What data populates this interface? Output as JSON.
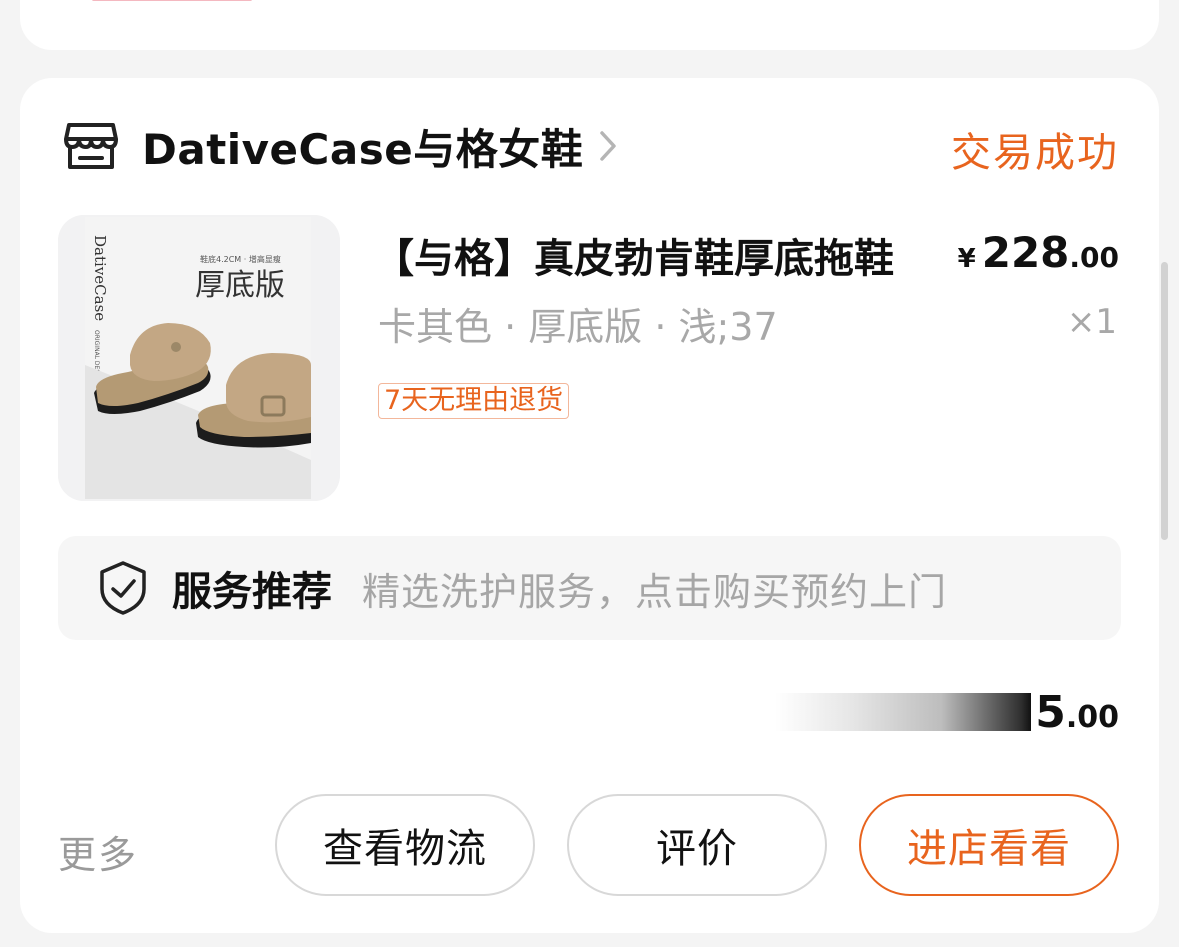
{
  "order": {
    "shop": {
      "name": "DativeCase与格女鞋",
      "icon": "store-icon"
    },
    "status": "交易成功",
    "product": {
      "title": "【与格】真皮勃肯鞋厚底拖鞋",
      "price_currency": "¥",
      "price_int": "228",
      "price_dec": ".00",
      "variant": "卡其色 · 厚底版 · 浅;37",
      "quantity": "×1",
      "return_tag": "7天无理由退货",
      "image": {
        "brand": "DativeCase",
        "brand_sub": "ORIGINAL DESIGN",
        "caption": "鞋底4.2CM · 增高显瘦",
        "label": "厚底版"
      }
    },
    "service": {
      "title": "服务推荐",
      "description": "精选洗护服务，点击购买预约上门",
      "icon": "shield-check-icon"
    },
    "total": {
      "int": "5",
      "dec": ".00"
    },
    "actions": {
      "more": "更多",
      "logistics": "查看物流",
      "review": "评价",
      "visit_shop": "进店看看"
    }
  },
  "colors": {
    "accent": "#e8641e",
    "background": "#f4f4f4",
    "card": "#ffffff",
    "muted_text": "#a8a8a8"
  }
}
